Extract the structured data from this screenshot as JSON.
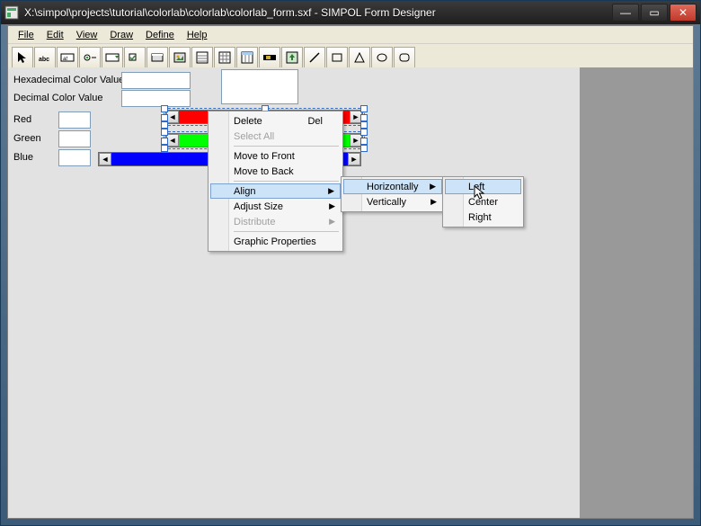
{
  "window": {
    "title": "X:\\simpol\\projects\\tutorial\\colorlab\\colorlab\\colorlab_form.sxf - SIMPOL Form Designer"
  },
  "menubar": {
    "items": [
      "File",
      "Edit",
      "View",
      "Draw",
      "Define",
      "Help"
    ]
  },
  "form": {
    "hex_label": "Hexadecimal Color Value",
    "dec_label": "Decimal Color Value",
    "red_label": "Red",
    "green_label": "Green",
    "blue_label": "Blue"
  },
  "colors": {
    "red": "#ff0000",
    "green": "#00ff00",
    "blue": "#0000ff",
    "selection": "#316ac5"
  },
  "context_menu": {
    "delete": "Delete",
    "delete_accel": "Del",
    "select_all": "Select All",
    "move_front": "Move to Front",
    "move_back": "Move to Back",
    "align": "Align",
    "adjust_size": "Adjust Size",
    "distribute": "Distribute",
    "graphic_props": "Graphic Properties"
  },
  "align_submenu": {
    "horizontally": "Horizontally",
    "vertically": "Vertically"
  },
  "horiz_submenu": {
    "left": "Left",
    "center": "Center",
    "right": "Right"
  },
  "toolbar_icons": [
    "pointer",
    "text-abc",
    "text-ital",
    "option",
    "combo",
    "checkbox",
    "button-sys",
    "button-bmp",
    "list",
    "grid",
    "edit-cols",
    "scroll-h",
    "scroll-v",
    "line",
    "rect",
    "triangle",
    "ellipse",
    "rounded"
  ]
}
